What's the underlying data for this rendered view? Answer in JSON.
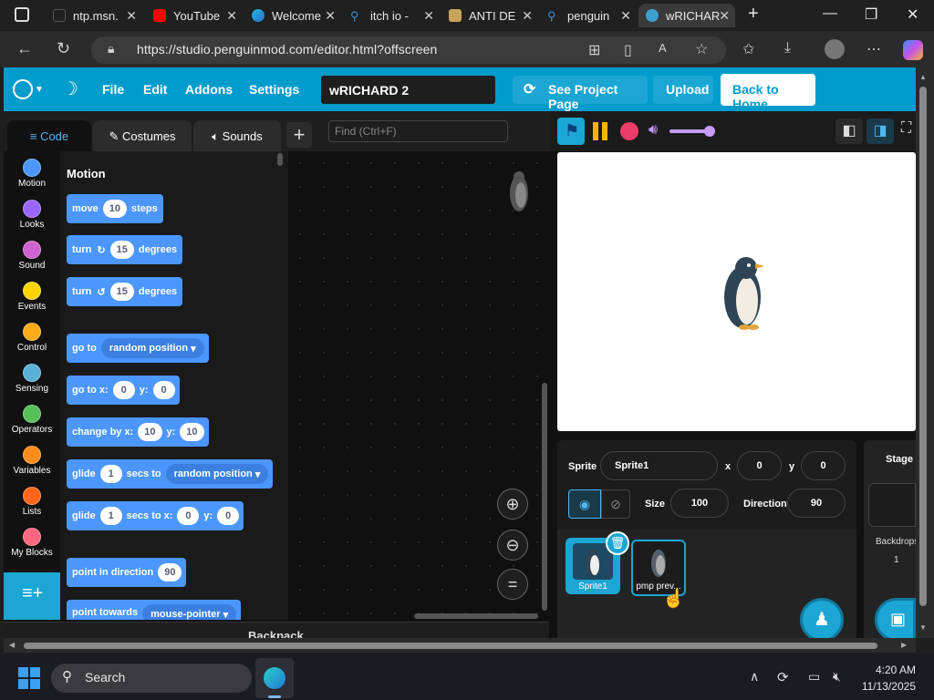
{
  "browser": {
    "tabs": [
      {
        "label": "ntp.msn.",
        "color": "#d13438"
      },
      {
        "label": "YouTube",
        "color": "#ff0000"
      },
      {
        "label": "Welcome",
        "color": "#1a73e8"
      },
      {
        "label": "itch io - ",
        "color": "#3c8cd8"
      },
      {
        "label": "ANTI DE",
        "color": "#c9a35b"
      },
      {
        "label": "penguin",
        "color": "#3c8cd8"
      },
      {
        "label": "wRICHAR",
        "color": "#3aa0d0"
      }
    ],
    "url": "https://studio.penguinmod.com/editor.html?offscreen"
  },
  "menu": {
    "file": "File",
    "edit": "Edit",
    "addons": "Addons",
    "settings": "Settings",
    "project_title": "wRICHARD 2",
    "see_project": "See Project Page",
    "upload": "Upload",
    "back_home": "Back to Home"
  },
  "editor_tabs": {
    "code": "Code",
    "costumes": "Costumes",
    "sounds": "Sounds"
  },
  "search": {
    "placeholder": "Find (Ctrl+F)"
  },
  "categories": [
    {
      "label": "Motion",
      "color": "#4c97ff"
    },
    {
      "label": "Looks",
      "color": "#9966ff"
    },
    {
      "label": "Sound",
      "color": "#cf63cf"
    },
    {
      "label": "Events",
      "color": "#ffd500"
    },
    {
      "label": "Control",
      "color": "#ffab19"
    },
    {
      "label": "Sensing",
      "color": "#5cb1d6"
    },
    {
      "label": "Operators",
      "color": "#59c059"
    },
    {
      "label": "Variables",
      "color": "#ff8c1a"
    },
    {
      "label": "Lists",
      "color": "#ff661a"
    },
    {
      "label": "My Blocks",
      "color": "#ff6680"
    }
  ],
  "palette": {
    "heading": "Motion",
    "move": {
      "a": "move",
      "v": "10",
      "b": "steps"
    },
    "turn_right": {
      "a": "turn",
      "v": "15",
      "b": "degrees"
    },
    "turn_left": {
      "a": "turn",
      "v": "15",
      "b": "degrees"
    },
    "goto": {
      "a": "go to",
      "v": "random position"
    },
    "goto_xy": {
      "a": "go to x:",
      "x": "0",
      "b": "y:",
      "y": "0"
    },
    "change_by": {
      "a": "change by x:",
      "x": "10",
      "b": "y:",
      "y": "10"
    },
    "glide": {
      "a": "glide",
      "v": "1",
      "b": "secs to",
      "t": "random position"
    },
    "glide_xy": {
      "a": "glide",
      "v": "1",
      "b": "secs to x:",
      "x": "0",
      "c": "y:",
      "y": "0"
    },
    "point_dir": {
      "a": "point in direction",
      "v": "90"
    },
    "point_towards": {
      "a": "point towards",
      "v": "mouse-pointer"
    }
  },
  "backpack": "Backpack",
  "sprite": {
    "label": "Sprite",
    "name": "Sprite1",
    "x_label": "x",
    "x": "0",
    "y_label": "y",
    "y": "0",
    "size_label": "Size",
    "size": "100",
    "direction_label": "Direction",
    "direction": "90"
  },
  "sprites": [
    {
      "name": "Sprite1"
    },
    {
      "name": "pmp prev..."
    }
  ],
  "stage_panel": {
    "title": "Stage",
    "backdrops_label": "Backdrops",
    "backdrops_count": "1"
  },
  "taskbar": {
    "search": "Search",
    "time": "4:20 AM",
    "date": "11/13/2025"
  }
}
